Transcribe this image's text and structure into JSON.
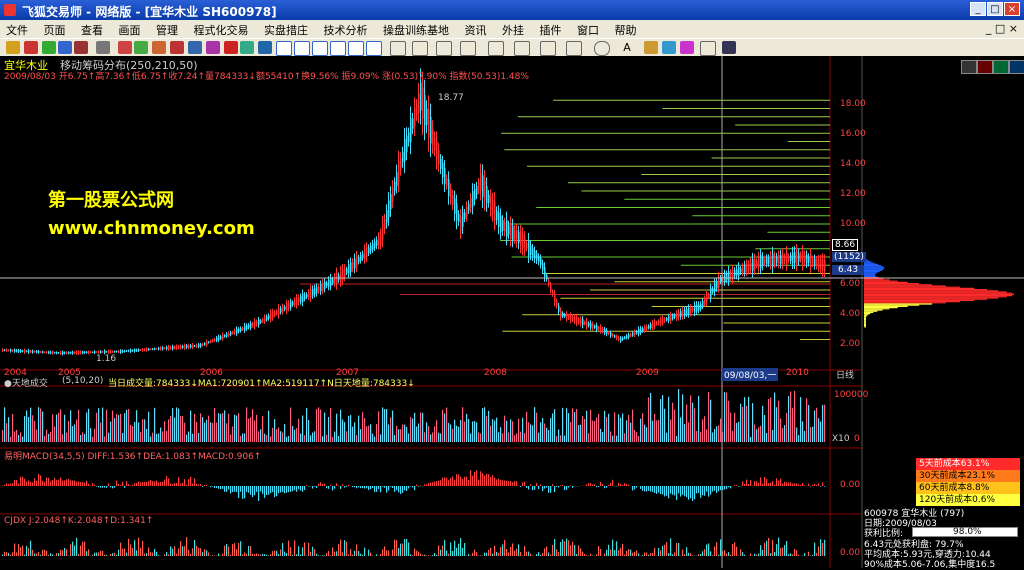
{
  "window": {
    "title": "飞狐交易师 - 网络版 - [宜华木业 SH600978]"
  },
  "menu": [
    "文件",
    "页面",
    "查看",
    "画面",
    "管理",
    "程式化交易",
    "实盘措庄",
    "技术分析",
    "操盘训练基地",
    "资讯",
    "外挂",
    "插件",
    "窗口",
    "帮助"
  ],
  "main_chart": {
    "stock_name": "宜华木业",
    "indicator": "移动筹码分布(250,210,50)",
    "ohlc_line": "2009/08/03 开6.75↑高7.36↑低6.75↑收7.24↑量784333↓额55410↑换9.56% 振9.09% 涨(0.53)7.90% 指数(50.53)1.48%",
    "watermark1": "第一股票公式网",
    "watermark2": "www.chnmoney.com",
    "peak_label": "18.77",
    "low_label": "1.16",
    "price_box": "(1152)",
    "price_top": "8.66",
    "price_cur": "6.43",
    "y_ticks": [
      "18.00",
      "16.00",
      "14.00",
      "12.00",
      "10.00",
      "8.00",
      "6.00",
      "4.00",
      "2.00"
    ],
    "x_ticks": [
      "2004",
      "2005",
      "2006",
      "2007",
      "2008",
      "2009",
      "2010"
    ],
    "cursor_date": "09/08/03,一",
    "period": "日线"
  },
  "volume_panel": {
    "title": "●天地成交",
    "params": "(5,10,20)",
    "line": "当日成交量:784333↓MA1:720901↑MA2:519117↑N日天地量:784333↓",
    "y_top": "100000",
    "y_bottom": "0",
    "scale": "X10"
  },
  "macd_panel": {
    "line": "易明MACD(34,5,5) DIFF:1.536↑DEA:1.083↑MACD:0.906↑",
    "y_mid": "0.00"
  },
  "cjdx_panel": {
    "line": "CJDX J:2.048↑K:2.048↑D:1.341↑",
    "y_mid": "0.00"
  },
  "cost_legend": [
    {
      "text": "5天前成本63.1%",
      "color": "#ff2a2a"
    },
    {
      "text": "30天前成本23.1%",
      "color": "#ff7a1a"
    },
    {
      "text": "60天前成本8.8%",
      "color": "#ffc21a"
    },
    {
      "text": "120天前成本0.6%",
      "color": "#ffff40"
    }
  ],
  "chip_info": {
    "code_name": "600978 宜华木业 (797)",
    "date": "日期:2009/08/03",
    "profit_label": "获利比例:",
    "profit_value": "98.0%",
    "profit_at": "6.43元处获利盘: 79.7%",
    "avg_cost": "平均成本:5.93元,穿透力:10.44",
    "cost_90": "90%成本5.06-7.06,集中度16.5"
  }
}
